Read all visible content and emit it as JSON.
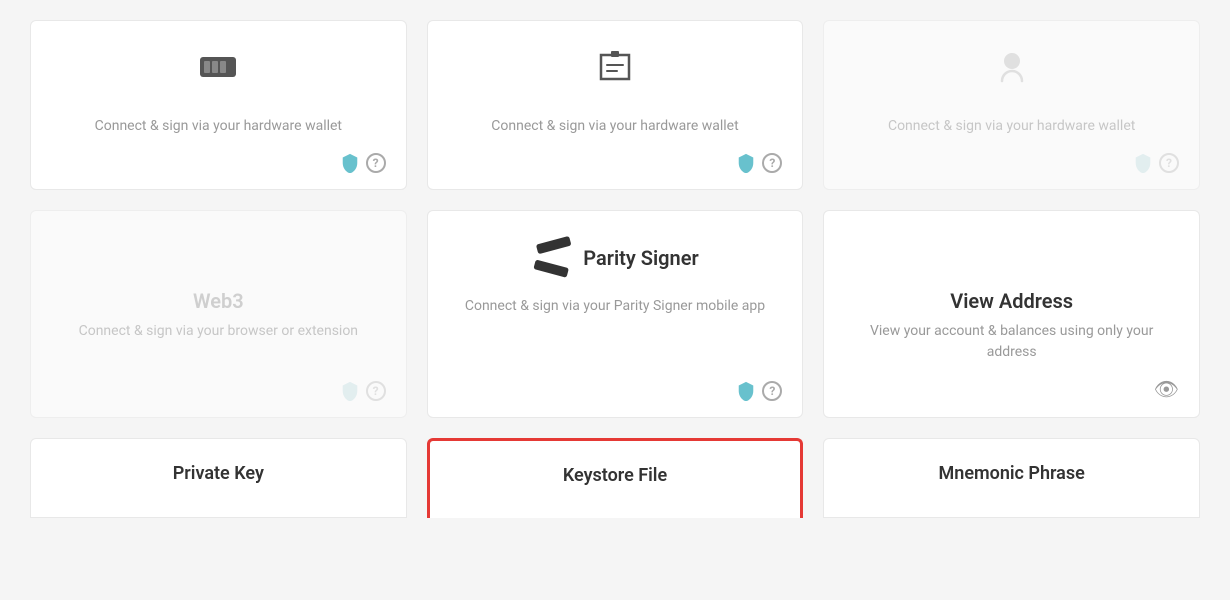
{
  "cards": [
    {
      "id": "hardware-1",
      "title": "",
      "description": "Connect & sign via your hardware wallet",
      "iconType": "hardware",
      "disabled": false,
      "selected": false,
      "footerType": "shield-question"
    },
    {
      "id": "hardware-2",
      "title": "",
      "description": "Connect & sign via your hardware wallet",
      "iconType": "hardware2",
      "disabled": false,
      "selected": false,
      "footerType": "shield-question"
    },
    {
      "id": "hardware-3",
      "title": "",
      "description": "Connect & sign via your hardware wallet",
      "iconType": "hardware3",
      "disabled": true,
      "selected": false,
      "footerType": "shield-question"
    },
    {
      "id": "web3",
      "title": "Web3",
      "description": "Connect & sign via your browser or extension",
      "iconType": "none",
      "disabled": true,
      "selected": false,
      "footerType": "shield-question"
    },
    {
      "id": "parity-signer",
      "title": "Parity Signer",
      "description": "Connect & sign via your Parity Signer mobile app",
      "iconType": "parity",
      "disabled": false,
      "selected": false,
      "footerType": "shield-question"
    },
    {
      "id": "view-address",
      "title": "View Address",
      "description": "View your account & balances using only your address",
      "iconType": "none",
      "disabled": false,
      "selected": false,
      "footerType": "eye"
    }
  ],
  "bottomCards": [
    {
      "id": "private-key",
      "title": "Private Key",
      "selected": false
    },
    {
      "id": "keystore-file",
      "title": "Keystore File",
      "selected": true
    },
    {
      "id": "mnemonic-phrase",
      "title": "Mnemonic Phrase",
      "selected": false
    }
  ]
}
